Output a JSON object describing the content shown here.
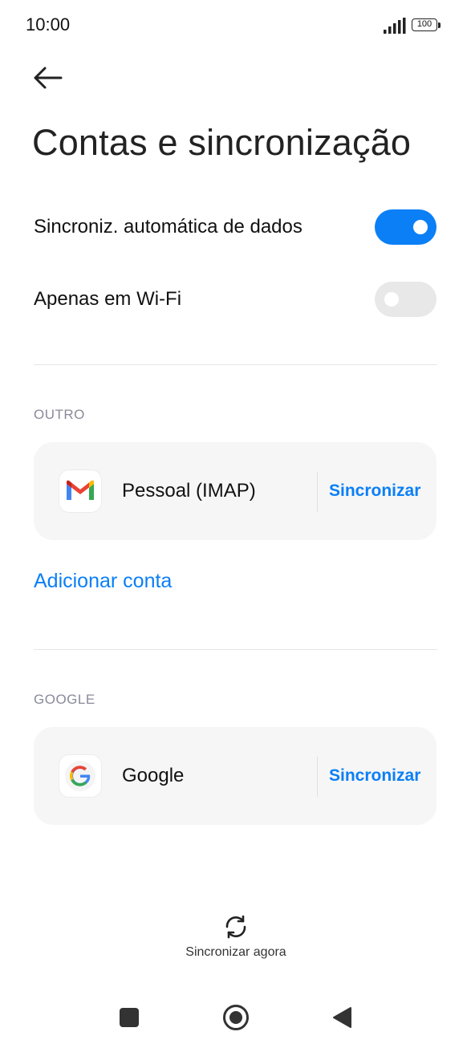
{
  "status_bar": {
    "time": "10:00",
    "battery": "100",
    "signal_icon": "signal-bars-icon",
    "battery_icon": "battery-icon"
  },
  "header": {
    "back_icon": "arrow-left-icon",
    "title": "Contas e sincronização"
  },
  "settings": {
    "auto_sync": {
      "label": "Sincroniz. automática de dados",
      "enabled": true
    },
    "wifi_only": {
      "label": "Apenas em Wi-Fi",
      "enabled": false
    }
  },
  "sections": [
    {
      "header": "OUTRO",
      "accounts": [
        {
          "name": "Pessoal (IMAP)",
          "icon": "gmail-icon",
          "action": "Sincronizar"
        }
      ]
    },
    {
      "header": "GOOGLE",
      "accounts": [
        {
          "name": "Google",
          "icon": "google-icon",
          "action": "Sincronizar"
        }
      ]
    }
  ],
  "add_account": "Adicionar conta",
  "sync_now": {
    "label": "Sincronizar agora",
    "icon": "sync-icon"
  },
  "navbar": {
    "recent_icon": "square-icon",
    "home_icon": "circle-icon",
    "back_icon": "triangle-back-icon"
  },
  "colors": {
    "accent": "#0a7ff6",
    "card_bg": "#f6f6f6",
    "section_header": "#8a8a9a",
    "switch_off": "#e8e8e8"
  }
}
